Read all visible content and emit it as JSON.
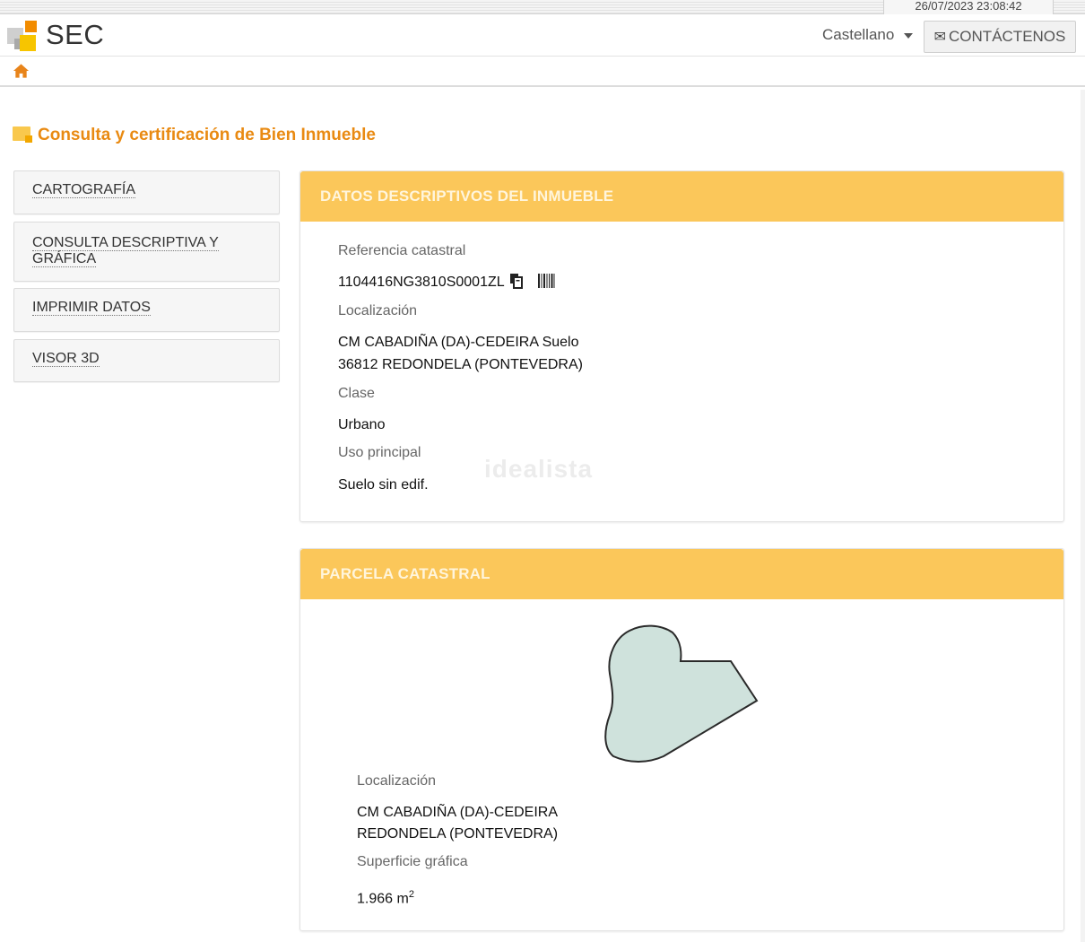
{
  "topbar": {
    "datetime": "26/07/2023  23:08:42"
  },
  "header": {
    "logo_text": "SEC",
    "language": "Castellano",
    "contact_label": "CONTÁCTENOS"
  },
  "page": {
    "title": "Consulta y certificación de Bien Inmueble"
  },
  "sidebar": {
    "items": [
      {
        "label": "CARTOGRAFÍA"
      },
      {
        "label": "CONSULTA DESCRIPTIVA Y GRÁFICA"
      },
      {
        "label": "IMPRIMIR DATOS"
      },
      {
        "label": "VISOR 3D"
      }
    ]
  },
  "datos": {
    "heading": "DATOS DESCRIPTIVOS DEL INMUEBLE",
    "ref_label": "Referencia catastral",
    "ref_value": "1104416NG3810S0001ZL",
    "loc_label": "Localización",
    "loc_line1": "CM CABADIÑA (DA)-CEDEIRA Suelo",
    "loc_line2": "36812 REDONDELA (PONTEVEDRA)",
    "clase_label": "Clase",
    "clase_value": "Urbano",
    "uso_label": "Uso principal",
    "uso_value": "Suelo sin edif."
  },
  "parcela": {
    "heading": "PARCELA CATASTRAL",
    "loc_label": "Localización",
    "loc_line1": "CM CABADIÑA (DA)-CEDEIRA",
    "loc_line2": "REDONDELA (PONTEVEDRA)",
    "sup_label": "Superficie gráfica",
    "sup_value": "1.966 m",
    "sup_unit_exp": "2"
  },
  "watermark": "idealista",
  "icons": {
    "home": "home-icon",
    "copy": "copy-icon",
    "barcode": "barcode-icon",
    "envelope": "envelope-icon",
    "caret": "caret-down-icon"
  },
  "colors": {
    "accent": "#e98a12",
    "panel_header": "#fbc75a",
    "parcel_fill": "#cfe2dc"
  }
}
